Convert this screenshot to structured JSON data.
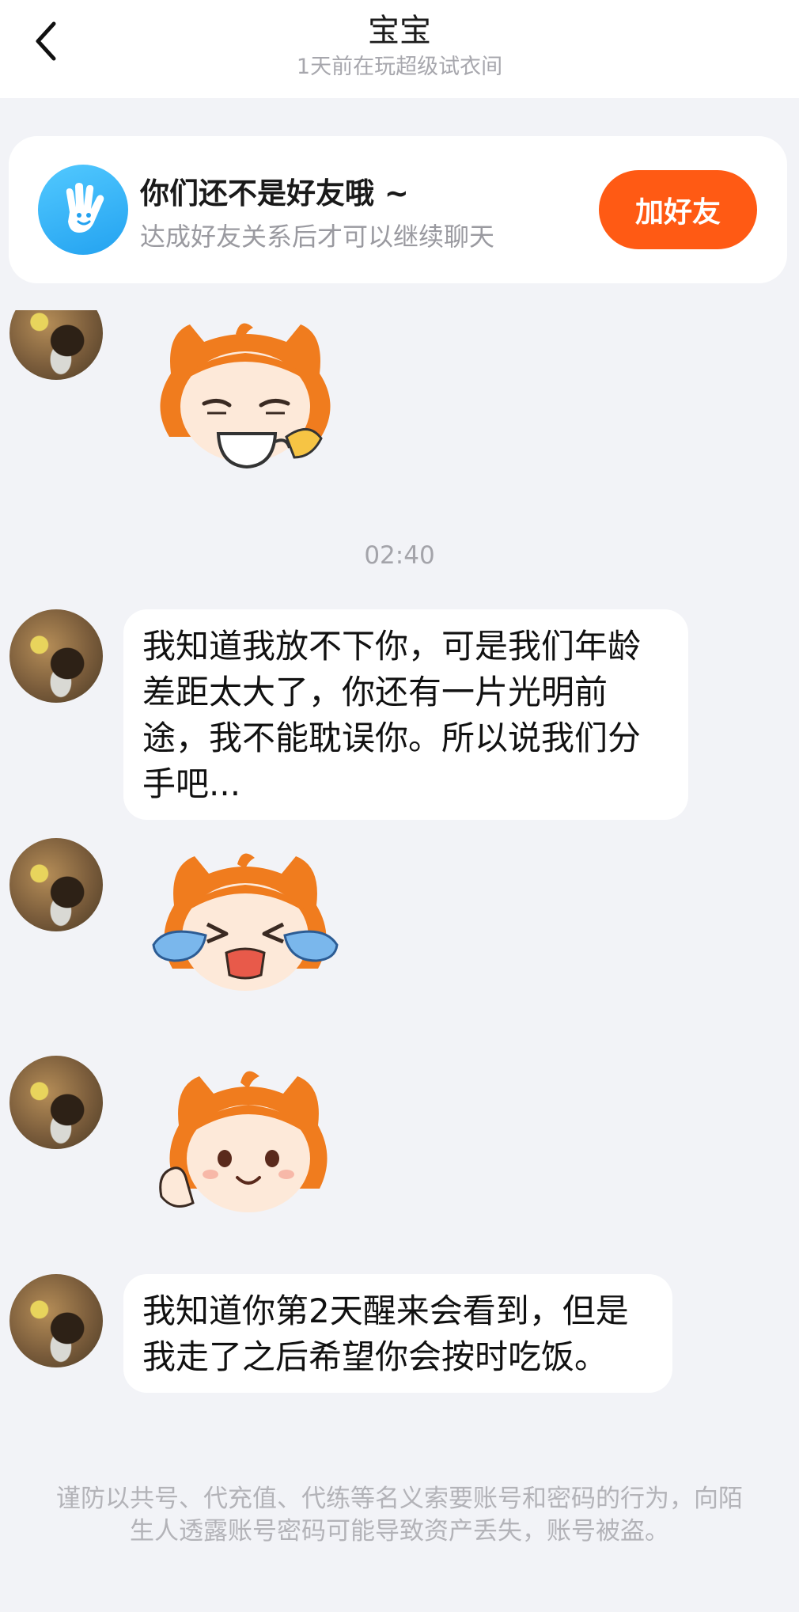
{
  "header": {
    "title": "宝宝",
    "subtitle": "1天前在玩超级试衣间"
  },
  "friend_card": {
    "title": "你们还不是好友哦 ~",
    "subtitle": "达成好友关系后才可以继续聊天",
    "add_button": "加好友"
  },
  "chat": {
    "timestamp": "02:40",
    "messages": [
      {
        "type": "sticker",
        "sticker": "mascot-sipping-tea"
      },
      {
        "type": "text",
        "text": "我知道我放不下你，可是我们年龄差距太大了，你还有一片光明前途，我不能耽误你。所以说我们分手吧..."
      },
      {
        "type": "sticker",
        "sticker": "mascot-crying"
      },
      {
        "type": "sticker",
        "sticker": "mascot-waving"
      },
      {
        "type": "text",
        "text": "我知道你第2天醒来会看到，但是我走了之后希望你会按时吃饭。"
      }
    ]
  },
  "warning": "谨防以共号、代充值、代练等名义索要账号和密码的行为，向陌生人透露账号密码可能导致资产丢失，账号被盗。",
  "colors": {
    "accent": "#ff5a14",
    "hand_icon": "#23a2f0",
    "background": "#f2f3f7"
  }
}
